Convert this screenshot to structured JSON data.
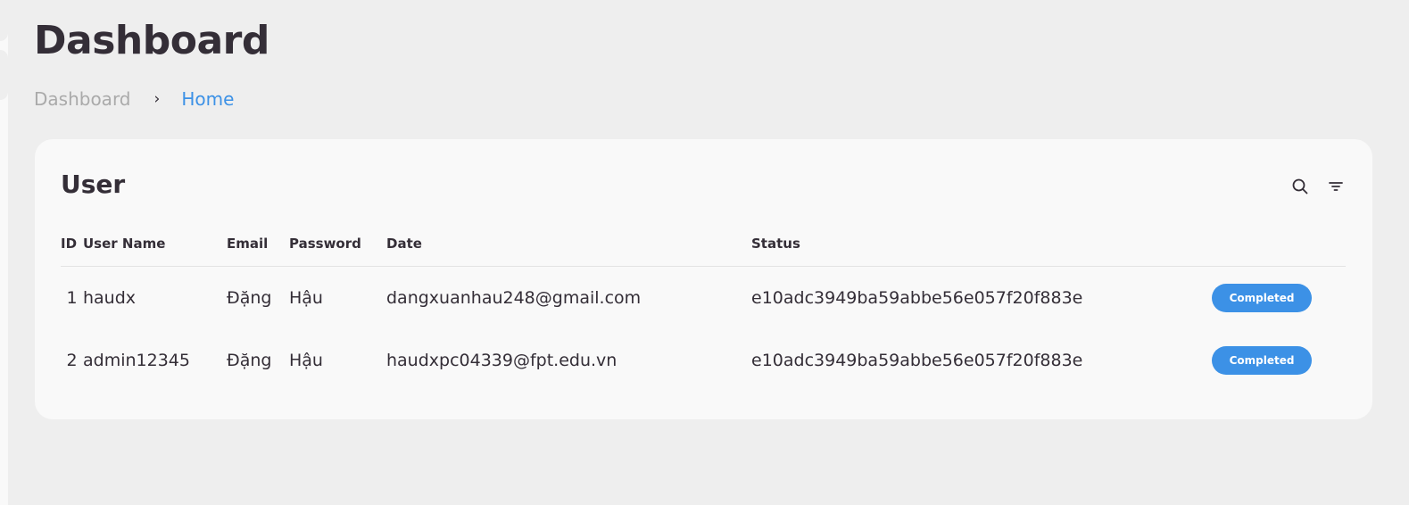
{
  "page": {
    "title": "Dashboard"
  },
  "breadcrumb": {
    "parent": "Dashboard",
    "separator": "›",
    "current": "Home"
  },
  "card": {
    "title": "User",
    "icons": [
      "search-icon",
      "filter-icon"
    ]
  },
  "table": {
    "headers": [
      "ID",
      "User Name",
      "Email",
      "Password",
      "Date",
      "Status"
    ],
    "rows": [
      {
        "id": "1",
        "username": "haudx",
        "col3": "Đặng",
        "col4": "Hậu",
        "col5": "dangxuanhau248@gmail.com",
        "col6": "e10adc3949ba59abbe56e057f20f883e",
        "status": "Completed"
      },
      {
        "id": "2",
        "username": "admin12345",
        "col3": "Đặng",
        "col4": "Hậu",
        "col5": "haudxpc04339@fpt.edu.vn",
        "col6": "e10adc3949ba59abbe56e057f20f883e",
        "status": "Completed"
      }
    ]
  },
  "colors": {
    "accent": "#3c91e6",
    "text": "#342e37",
    "background": "#eeeeee",
    "card": "#f9f9f9"
  }
}
